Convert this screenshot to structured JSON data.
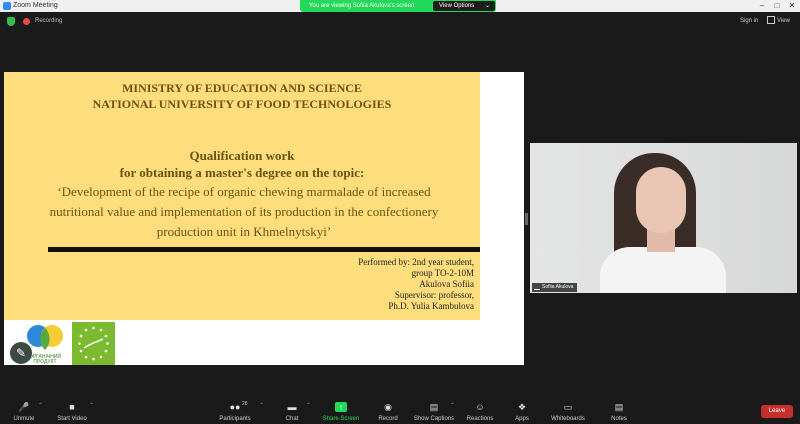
{
  "window": {
    "title": "Zoom Meeting"
  },
  "banner": {
    "message": "You are viewing Sofiia Akulova's screen",
    "view_options": "View Options"
  },
  "status": {
    "recording": "Recording",
    "sign_in": "Sign in",
    "view": "View"
  },
  "slide": {
    "org_line1": "MINISTRY OF EDUCATION AND SCIENCE",
    "org_line2": "NATIONAL UNIVERSITY OF FOOD TECHNOLOGIES",
    "qual_line1": "Qualification work",
    "qual_line2": "for obtaining a master's degree on the topic:",
    "topic": "‘Development of the recipe of organic chewing marmalade of increased nutritional value and implementation of its production in the confectionery production unit in Khmelnytskyi’",
    "performer": [
      "Performed by: 2nd year student,",
      "group TO-2-10M",
      "Akulova Sofiia",
      "Supervisor: professor,",
      "Ph.D. Yulia Kambulova"
    ],
    "logo1_text": "ОРГАНІЧНИЙ ПРОДУКТ"
  },
  "video": {
    "name": "Sofiia Akulova"
  },
  "toolbar": {
    "items": [
      {
        "label": "Unmute",
        "icon": "microphone-muted-icon"
      },
      {
        "label": "Start Video",
        "icon": "video-off-icon"
      },
      {
        "label": "Participants",
        "icon": "participants-icon",
        "count": "28"
      },
      {
        "label": "Chat",
        "icon": "chat-icon"
      },
      {
        "label": "Share Screen",
        "icon": "share-screen-icon"
      },
      {
        "label": "Record",
        "icon": "record-icon"
      },
      {
        "label": "Show Captions",
        "icon": "captions-icon"
      },
      {
        "label": "Reactions",
        "icon": "reactions-icon"
      },
      {
        "label": "Apps",
        "icon": "apps-icon"
      },
      {
        "label": "Whiteboards",
        "icon": "whiteboard-icon"
      },
      {
        "label": "Notes",
        "icon": "notes-icon"
      }
    ],
    "leave": "Leave"
  },
  "colors": {
    "share_green": "#23d959",
    "slide_yellow": "#fddd7c",
    "leave_red": "#c4302b"
  }
}
